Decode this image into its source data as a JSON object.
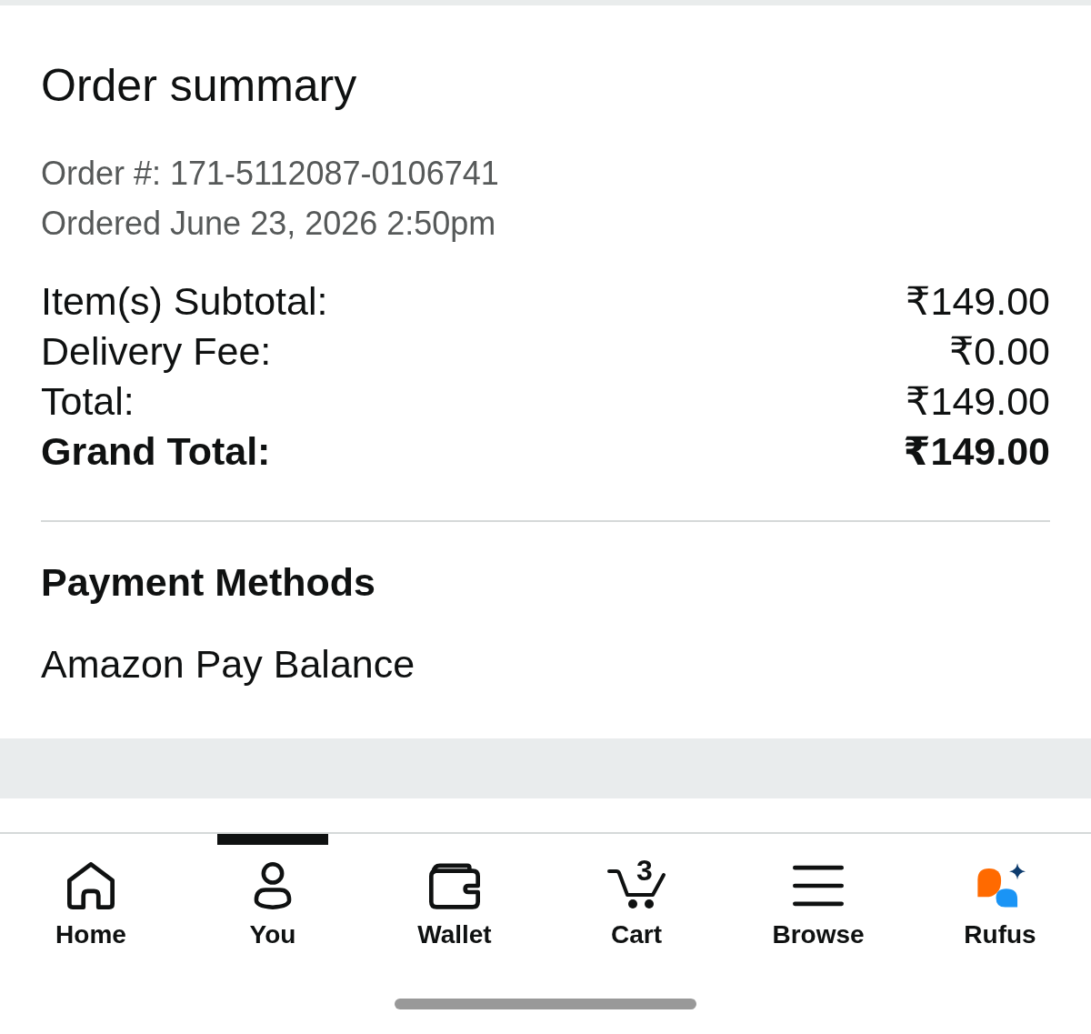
{
  "order_summary": {
    "title": "Order summary",
    "order_number": "Order #: 171-5112087-0106741",
    "ordered_date": "Ordered June 23, 2026 2:50pm",
    "totals": [
      {
        "label": "Item(s) Subtotal:",
        "amount": "₹149.00",
        "kind": "line"
      },
      {
        "label": "Delivery Fee:",
        "amount": "₹0.00",
        "kind": "line"
      },
      {
        "label": "Total:",
        "amount": "₹149.00",
        "kind": "line"
      },
      {
        "label": "Grand Total:",
        "amount": "₹149.00",
        "kind": "grand"
      }
    ]
  },
  "payment": {
    "title": "Payment Methods",
    "method": "Amazon Pay Balance"
  },
  "bottom_nav": {
    "items": [
      {
        "label": "Home",
        "kind": "home",
        "selected": false
      },
      {
        "label": "You",
        "kind": "person",
        "selected": true
      },
      {
        "label": "Wallet",
        "kind": "wallet",
        "selected": false
      },
      {
        "label": "Cart",
        "kind": "cart",
        "count": "3",
        "selected": false
      },
      {
        "label": "Browse",
        "kind": "menu",
        "selected": false
      },
      {
        "label": "Rufus",
        "kind": "assistant",
        "selected": false
      }
    ]
  }
}
